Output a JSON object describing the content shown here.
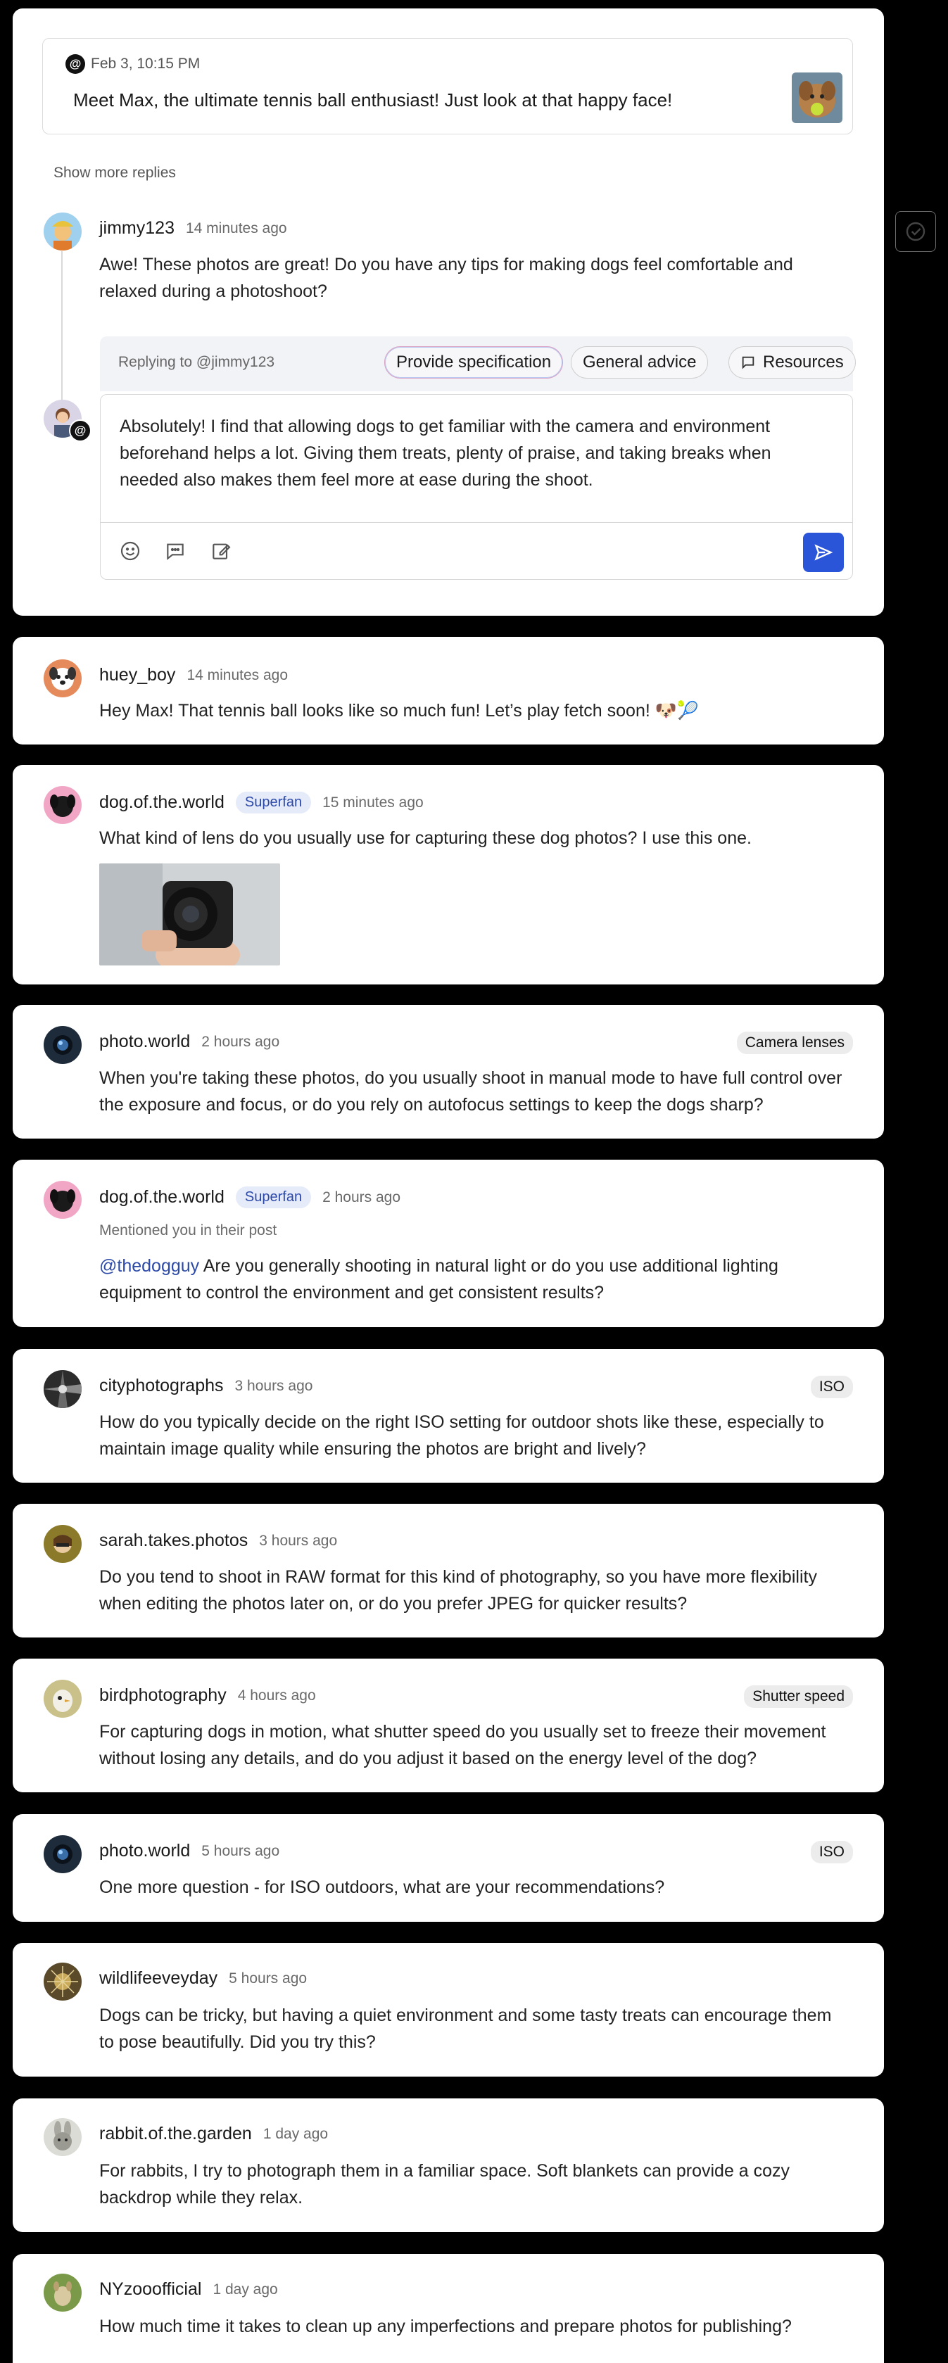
{
  "thread": {
    "quote": {
      "date": "Feb 3, 10:15 PM",
      "text": "Meet Max, the ultimate tennis ball enthusiast! Just look at that happy face!"
    },
    "show_more": "Show more replies",
    "comment": {
      "user": "jimmy123",
      "time": "14 minutes ago",
      "text": "Awe! These photos are great! Do you have any tips for making dogs feel comfortable and relaxed during a photoshoot?"
    },
    "reply": {
      "replying_to": "Replying to @jimmy123",
      "chips": [
        "Provide specification",
        "General advice",
        "Resources"
      ],
      "draft": "Absolutely! I find that allowing dogs to get familiar with the camera and environment beforehand helps a lot. Giving them treats, plenty of praise, and taking breaks when needed also makes them feel more at ease during the shoot.",
      "tools": [
        "smile-icon",
        "comment-icon",
        "edit-icon"
      ],
      "send_icon": "send-icon"
    }
  },
  "comments": [
    {
      "user": "huey_boy",
      "time": "14 minutes ago",
      "text": "Hey Max! That tennis ball looks like so much fun! Let’s play fetch soon! 🐶🎾"
    },
    {
      "user": "dog.of.the.world",
      "badge": "Superfan",
      "time": "15 minutes ago",
      "text": "What kind of lens do you usually use for capturing these dog photos? I use this one."
    },
    {
      "user": "photo.world",
      "time": "2 hours ago",
      "tag": "Camera lenses",
      "text": "When you're taking these photos, do you usually shoot in manual mode to have full control over the exposure and focus, or do you rely on autofocus settings to keep the dogs sharp?"
    },
    {
      "user": "dog.of.the.world",
      "badge": "Superfan",
      "time": "2 hours ago",
      "note": "Mentioned you in their post",
      "mention": "@thedogguy",
      "text": " Are you generally shooting in natural light or do you use additional lighting equipment to control the environment and get consistent results?"
    },
    {
      "user": "cityphotographs",
      "time": "3 hours ago",
      "tag": "ISO",
      "text": "How do you typically decide on the right ISO setting for outdoor shots like these, especially to maintain image quality while ensuring the photos are bright and lively?"
    },
    {
      "user": "sarah.takes.photos",
      "time": "3 hours ago",
      "text": "Do you tend to shoot in RAW format for this kind of photography, so you have more flexibility when editing the photos later on, or do you prefer JPEG for quicker results?"
    },
    {
      "user": "birdphotography",
      "time": "4 hours ago",
      "tag": "Shutter speed",
      "text": "For capturing dogs in motion, what shutter speed do you usually set to freeze their movement without losing any details, and do you adjust it based on the energy level of the dog?"
    },
    {
      "user": "photo.world",
      "time": "5 hours ago",
      "tag": "ISO",
      "text": "One more question - for ISO outdoors, what are your recommendations?"
    },
    {
      "user": "wildlifeeveyday",
      "time": "5 hours ago",
      "text": "Dogs can be tricky, but having a quiet environment and some tasty treats can encourage them to pose beautifully. Did you try this?"
    },
    {
      "user": "rabbit.of.the.garden",
      "time": "1 day ago",
      "text": "For rabbits, I try to photograph them in a familiar space. Soft blankets can provide a cozy backdrop while they relax."
    },
    {
      "user": "NYzooofficial",
      "time": "1 day ago",
      "text": "How much time it takes to clean up any imperfections and prepare photos for publishing?"
    }
  ],
  "colors": {
    "accent": "#2b55d8",
    "badge_bg": "#e6ebfa",
    "badge_text": "#2d4aa8"
  }
}
